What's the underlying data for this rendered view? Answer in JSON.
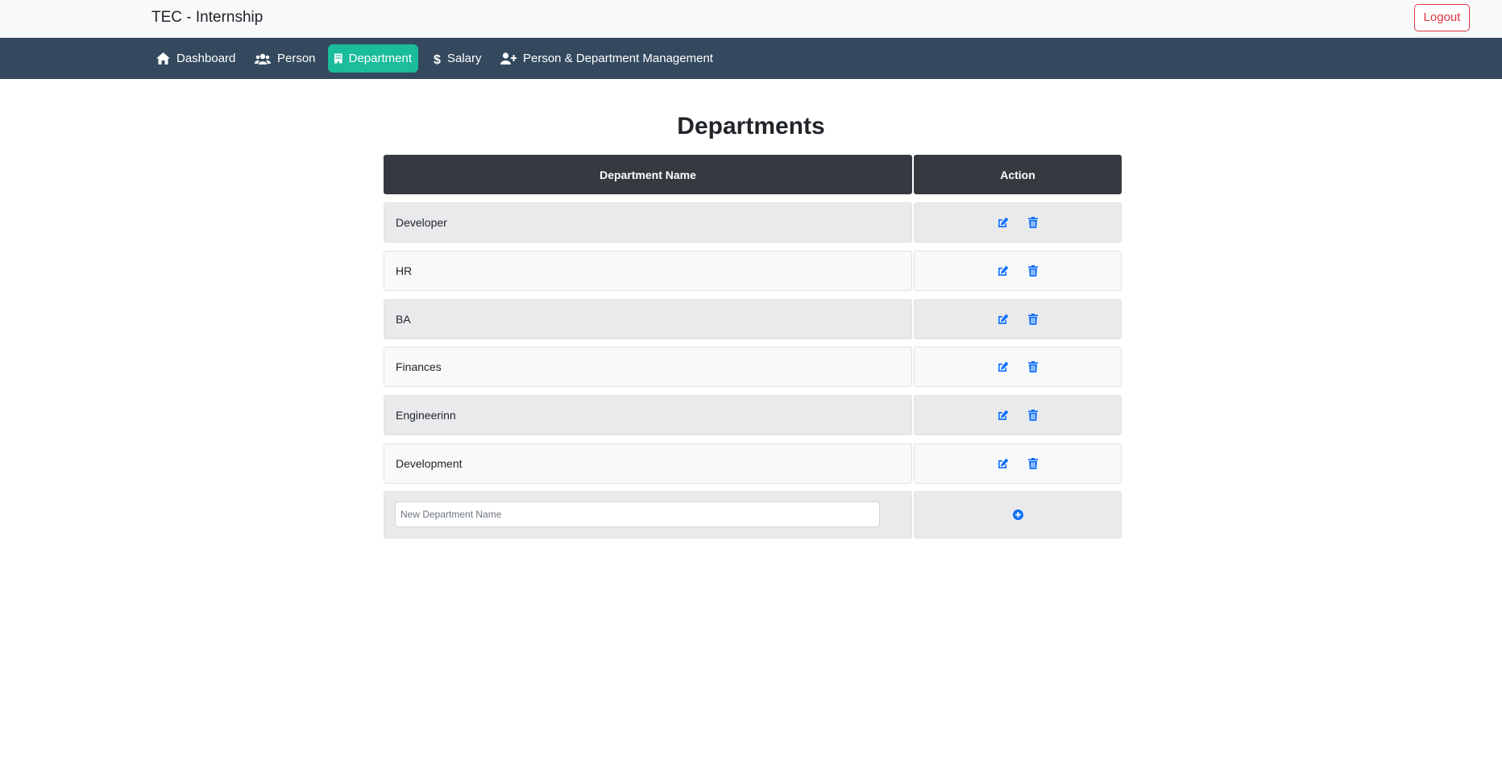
{
  "header": {
    "brand": "TEC - Internship",
    "logout_label": "Logout"
  },
  "nav": {
    "items": [
      {
        "label": "Dashboard",
        "icon": "home-icon"
      },
      {
        "label": "Person",
        "icon": "users-icon"
      },
      {
        "label": "Department",
        "icon": "building-icon",
        "active": true
      },
      {
        "label": "Salary",
        "icon": "dollar-icon"
      },
      {
        "label": "Person & Department Management",
        "icon": "user-plus-icon"
      }
    ]
  },
  "main": {
    "title": "Departments",
    "columns": [
      "Department Name",
      "Action"
    ],
    "departments": [
      "Developer",
      "HR",
      "BA",
      "Finances",
      "Engineerinn",
      "Development"
    ],
    "new_placeholder": "New Department Name"
  },
  "colors": {
    "accent": "#1abc9c",
    "nav_bg": "#34495e",
    "header_dark": "#343a40",
    "icon_blue": "#0d6efd",
    "logout_red": "#dc3545"
  }
}
